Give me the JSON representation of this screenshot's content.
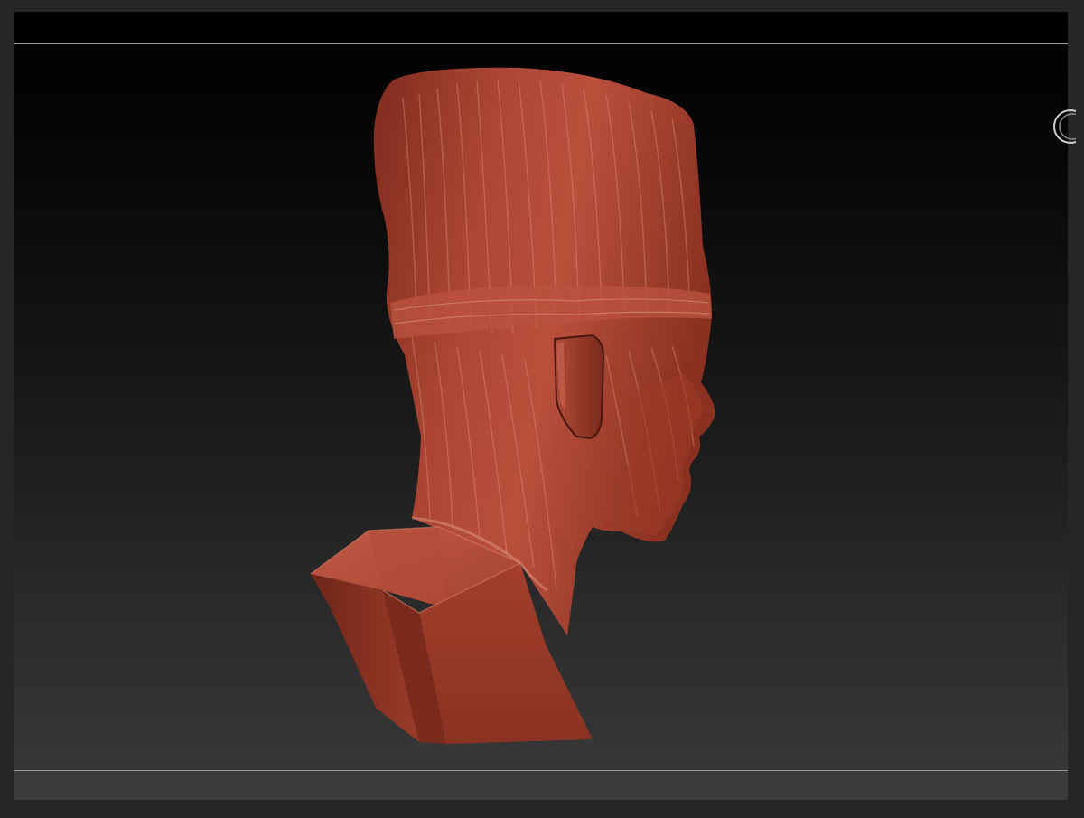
{
  "viewport": {
    "background_top": "#000000",
    "background_bottom": "#3a3a3a",
    "guide_line_color": "#9a9a9a"
  },
  "model": {
    "material_color": "#a8422f",
    "highlight_color": "#d77a66",
    "shadow_color": "#5a1d12"
  },
  "icons": {
    "rotate_handle": "circle-rotate-icon"
  }
}
